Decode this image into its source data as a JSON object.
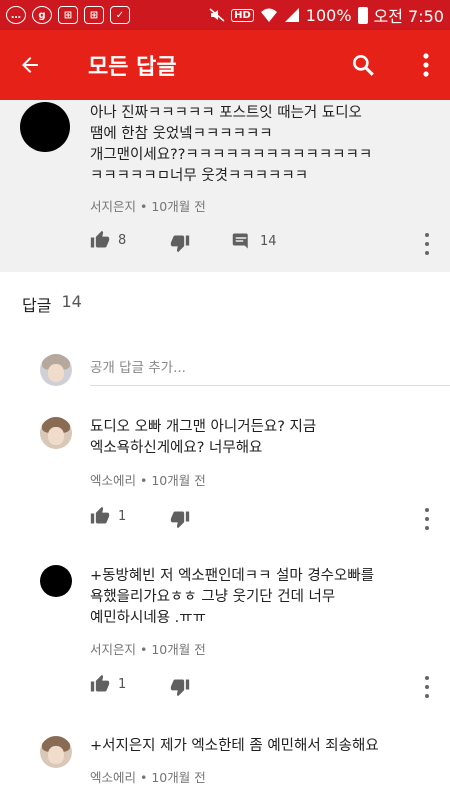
{
  "status_bar": {
    "battery_text": "100%",
    "time": "오전 7:50",
    "icons": [
      "message-icon",
      "g-icon",
      "app-icon",
      "app-icon",
      "clipboard-icon",
      "mute-icon",
      "hd-icon",
      "wifi-icon",
      "signal-icon",
      "battery-icon"
    ],
    "hd_label": "HD"
  },
  "app_bar": {
    "title": "모든 답글",
    "colors": {
      "bar": "#e62117",
      "status": "#cc181e"
    }
  },
  "parent_comment": {
    "text_line1": "아나 진짜ㅋㅋㅋㅋㅋ 포스트잇 때는거 됴디오",
    "text_line2": "땜에 한참 웃었넼ㅋㅋㅋㅋㅋㅋ",
    "text_line3": "개그맨이세요??ㅋㅋㅋㅋㅋㅋㅋㅋㅋㅋㅋㅋㅋㅋ",
    "text_line4": "ㅋㅋㅋㅋㅋㅁ너무 웃겻ㅋㅋㅋㅋㅋㅋ",
    "meta": "서지은지 • 10개월 전",
    "likes": "8",
    "replies": "14"
  },
  "replies_header": {
    "label": "답글",
    "count": "14"
  },
  "add_reply": {
    "placeholder": "공개 답글 추가..."
  },
  "replies": [
    {
      "line1": "됴디오 오빠 개그맨 아니거든요? 지금",
      "line2": "엑소욕하신게에요? 너무해요",
      "meta": "엑소에리 • 10개월 전",
      "likes": "1"
    },
    {
      "line1": "+동방혜빈 저 엑소팬인데ㅋㅋ 설마 경수오빠를",
      "line2": "욕했을리가요ㅎㅎ 그냥 웃기단 건데 너무",
      "line3": "예민하시네용 .ㅠㅠ",
      "meta": "서지은지 • 10개월 전",
      "likes": "1"
    },
    {
      "line1": "+서지은지 제가 엑소한테 좀 예민해서 죄송해요",
      "meta": "엑소에리 • 10개월 전"
    }
  ]
}
